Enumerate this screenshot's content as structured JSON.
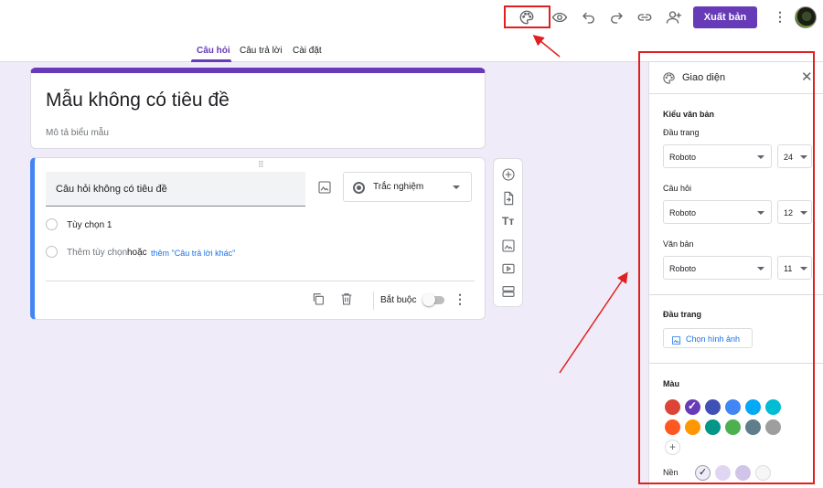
{
  "header": {
    "publish_label": "Xuất bản",
    "icons": [
      "palette-icon",
      "preview-eye-icon",
      "undo-icon",
      "redo-icon",
      "link-icon",
      "add-collaborator-icon",
      "more-vert-icon"
    ]
  },
  "tabs": [
    {
      "label": "Câu hỏi",
      "active": true
    },
    {
      "label": "Câu trả lời",
      "active": false
    },
    {
      "label": "Cài đặt",
      "active": false
    }
  ],
  "form": {
    "title": "Mẫu không có tiêu đề",
    "description": "Mô tả biểu mẫu"
  },
  "question": {
    "title": "Câu hỏi không có tiêu đề",
    "type": "Trắc nghiệm",
    "option1": "Tùy chọn 1",
    "add_option": "Thêm tùy chọn",
    "or": "hoặc",
    "add_other": "thêm \"Câu trả lời khác\"",
    "required_label": "Bắt buộc",
    "required": false
  },
  "theme_panel": {
    "title": "Giao diện",
    "text_style_heading": "Kiểu văn bản",
    "header_label": "Đầu trang",
    "header_font": "Roboto",
    "header_size": "24",
    "question_label": "Câu hỏi",
    "question_font": "Roboto",
    "question_size": "12",
    "text_label": "Văn bản",
    "text_font": "Roboto",
    "text_size": "11",
    "header_image_heading": "Đầu trang",
    "choose_image": "Chọn hình ảnh",
    "color_heading": "Màu",
    "colors": [
      "#db4437",
      "#673ab7",
      "#3f51b5",
      "#4285f4",
      "#03a9f4",
      "#00bcd4",
      "#ff5722",
      "#ff9800",
      "#009688",
      "#4caf50",
      "#607d8b",
      "#9e9e9e"
    ],
    "selected_color": "#673ab7",
    "background_label": "Nền",
    "backgrounds": [
      "#f0ebf8",
      "#e0d6f2",
      "#d1c4e9",
      "#f6f6f6"
    ],
    "selected_background": "#f0ebf8"
  },
  "accent": "#673ab7",
  "annotation_color": "#e02020"
}
